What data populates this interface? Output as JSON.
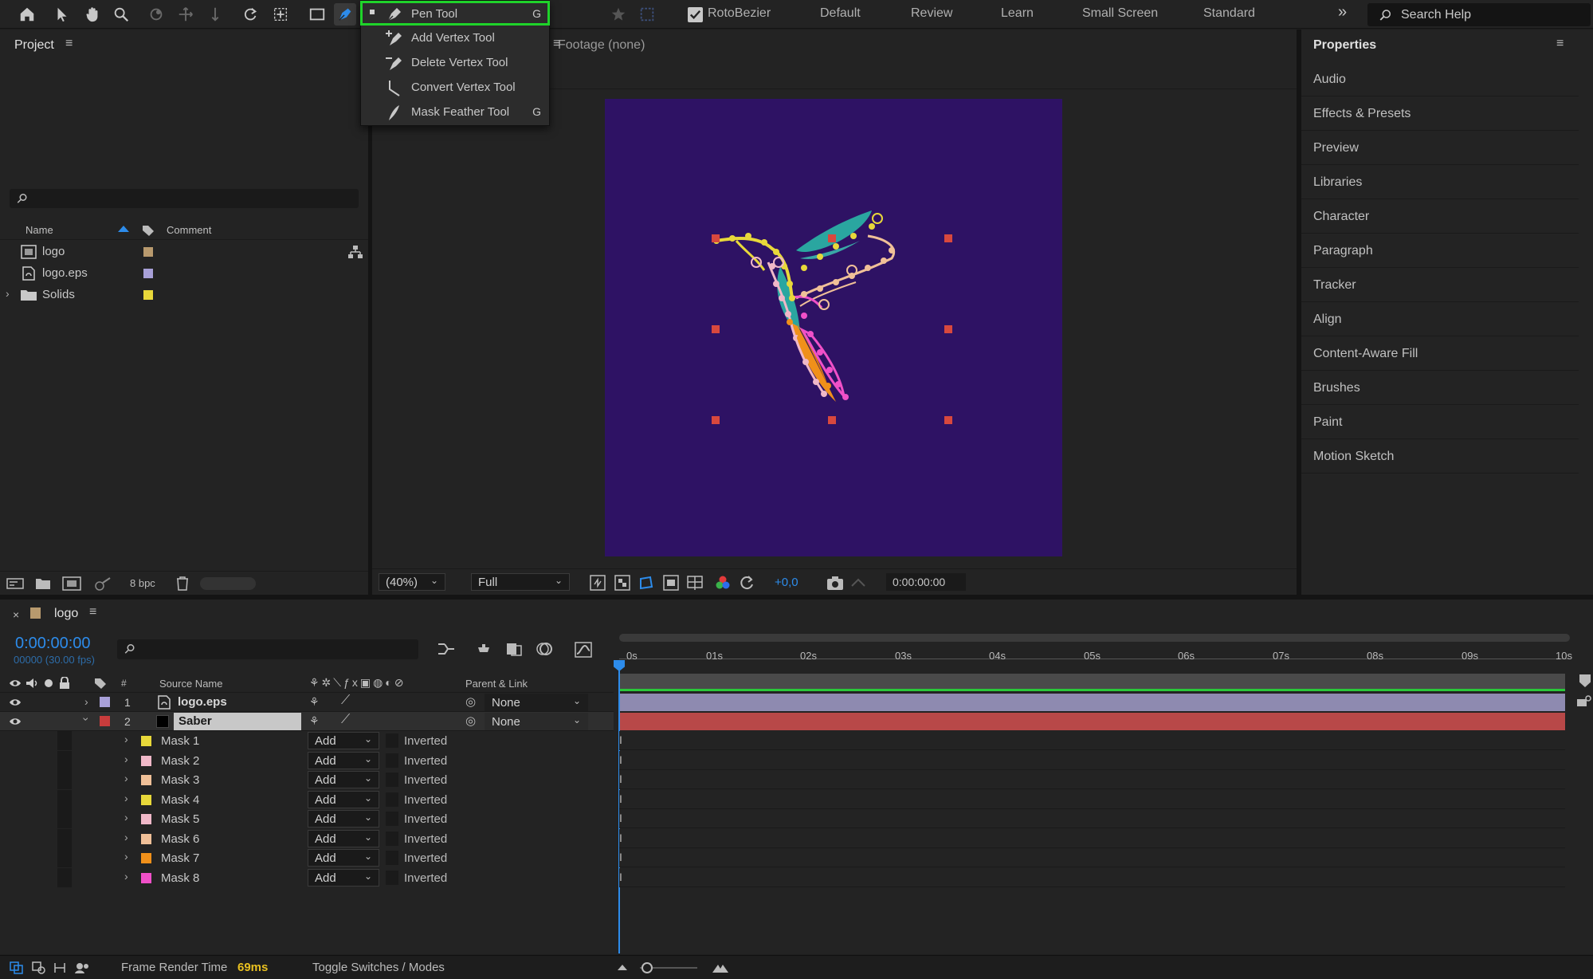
{
  "toolbar": {
    "rotobezier_label": "RotoBezier",
    "workspaces": [
      "Default",
      "Review",
      "Learn",
      "Small Screen",
      "Standard"
    ],
    "search_placeholder": "Search Help"
  },
  "pen_menu": {
    "items": [
      {
        "label": "Pen Tool",
        "key": "G"
      },
      {
        "label": "Add Vertex Tool",
        "key": ""
      },
      {
        "label": "Delete Vertex Tool",
        "key": ""
      },
      {
        "label": "Convert Vertex Tool",
        "key": ""
      },
      {
        "label": "Mask Feather Tool",
        "key": "G"
      }
    ]
  },
  "project": {
    "title": "Project",
    "col_name": "Name",
    "col_comment": "Comment",
    "items": [
      {
        "name": "logo",
        "color": "#b89a6e"
      },
      {
        "name": "logo.eps",
        "color": "#a8a0d8"
      },
      {
        "name": "Solids",
        "color": "#e8d83a"
      }
    ],
    "bpc": "8 bpc"
  },
  "viewer": {
    "footage_label": "Footage (none)",
    "zoom": "(40%)",
    "resolution": "Full",
    "exposure": "+0,0",
    "timecode": "0:00:00:00",
    "canvas_color": "#2e1264"
  },
  "properties": {
    "title": "Properties",
    "items": [
      "Audio",
      "Effects & Presets",
      "Preview",
      "Libraries",
      "Character",
      "Paragraph",
      "Tracker",
      "Align",
      "Content-Aware Fill",
      "Brushes",
      "Paint",
      "Motion Sketch"
    ]
  },
  "timeline": {
    "comp_name": "logo",
    "timecode": "0:00:00:00",
    "fps": "00000 (30.00 fps)",
    "col_num": "#",
    "col_source": "Source Name",
    "col_parent": "Parent & Link",
    "ruler": [
      "0s",
      "01s",
      "02s",
      "03s",
      "04s",
      "05s",
      "06s",
      "07s",
      "08s",
      "09s",
      "10s"
    ],
    "layers": [
      {
        "num": "1",
        "name": "logo.eps",
        "color": "#a8a0d8",
        "parent": "None"
      },
      {
        "num": "2",
        "name": "Saber",
        "color": "#c83c3c",
        "parent": "None"
      }
    ],
    "masks": [
      {
        "name": "Mask 1",
        "color": "#e8d83a",
        "mode": "Add",
        "inverted": "Inverted"
      },
      {
        "name": "Mask 2",
        "color": "#f0b8c8",
        "mode": "Add",
        "inverted": "Inverted"
      },
      {
        "name": "Mask 3",
        "color": "#f0c098",
        "mode": "Add",
        "inverted": "Inverted"
      },
      {
        "name": "Mask 4",
        "color": "#e8d83a",
        "mode": "Add",
        "inverted": "Inverted"
      },
      {
        "name": "Mask 5",
        "color": "#f0b8c8",
        "mode": "Add",
        "inverted": "Inverted"
      },
      {
        "name": "Mask 6",
        "color": "#f0c098",
        "mode": "Add",
        "inverted": "Inverted"
      },
      {
        "name": "Mask 7",
        "color": "#f0901a",
        "mode": "Add",
        "inverted": "Inverted"
      },
      {
        "name": "Mask 8",
        "color": "#f050c8",
        "mode": "Add",
        "inverted": "Inverted"
      }
    ]
  },
  "status": {
    "frame_render_label": "Frame Render Time",
    "frame_render_value": "69ms",
    "toggle_label": "Toggle Switches / Modes"
  }
}
